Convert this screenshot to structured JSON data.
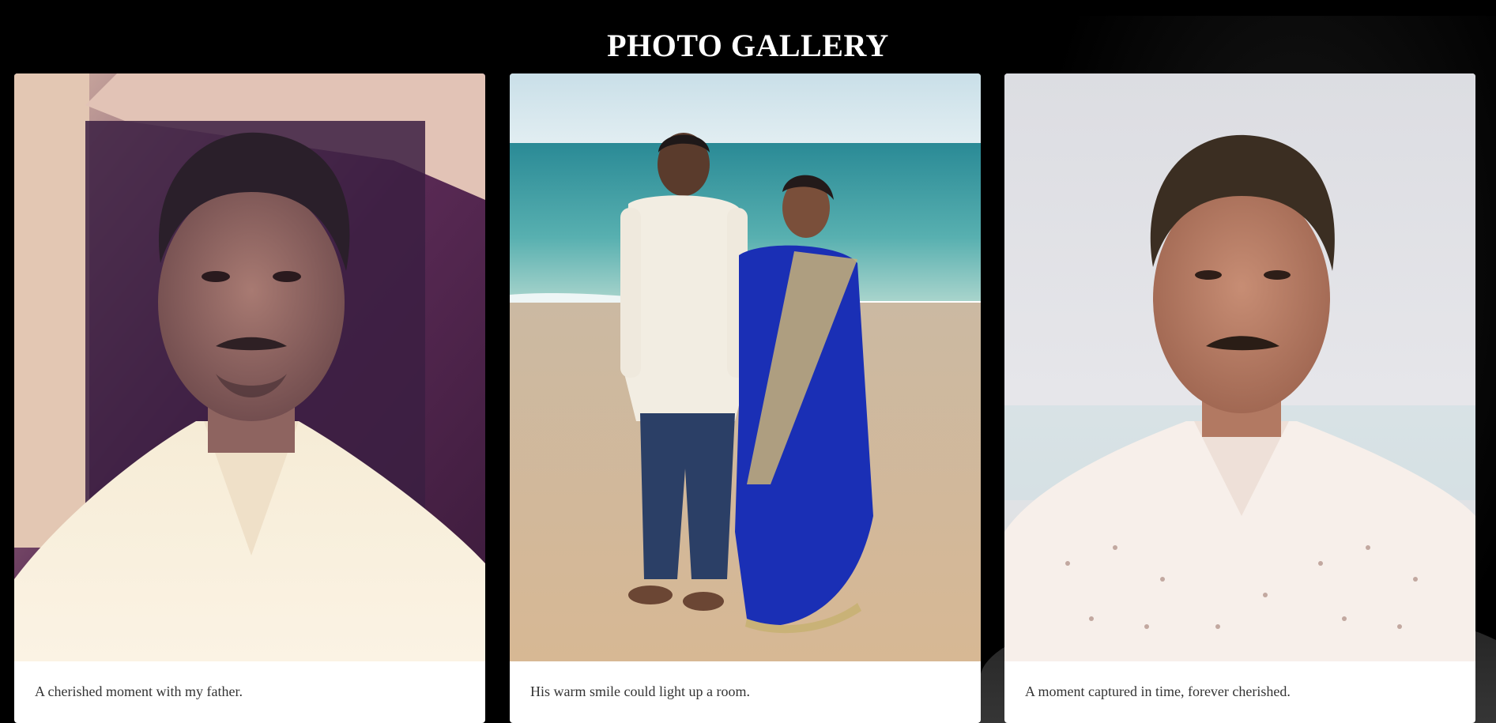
{
  "header": {
    "title": "PHOTO GALLERY"
  },
  "gallery": {
    "items": [
      {
        "caption": "A cherished moment with my father.",
        "icon": "portrait-photo"
      },
      {
        "caption": "His warm smile could light up a room.",
        "icon": "beach-couple-photo"
      },
      {
        "caption": "A moment captured in time, forever cherished.",
        "icon": "portrait-photo"
      }
    ]
  },
  "colors": {
    "page_background": "#000000",
    "card_background": "#ffffff",
    "title_color": "#ffffff",
    "caption_color": "#333333"
  }
}
